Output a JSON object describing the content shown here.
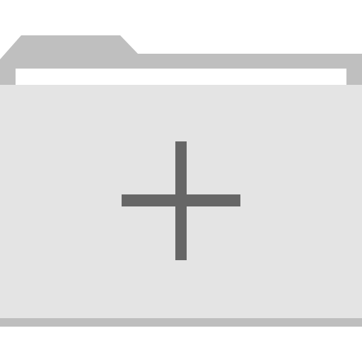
{
  "icon": {
    "name": "new-folder-icon",
    "glyph": "plus-icon"
  },
  "colors": {
    "background": "#ffffff",
    "folder_tab": "#bfbfbf",
    "folder_paper": "#ffffff",
    "folder_body": "#e4e4e4",
    "folder_bottom_edge": "#bebebe",
    "plus": "#666666"
  }
}
